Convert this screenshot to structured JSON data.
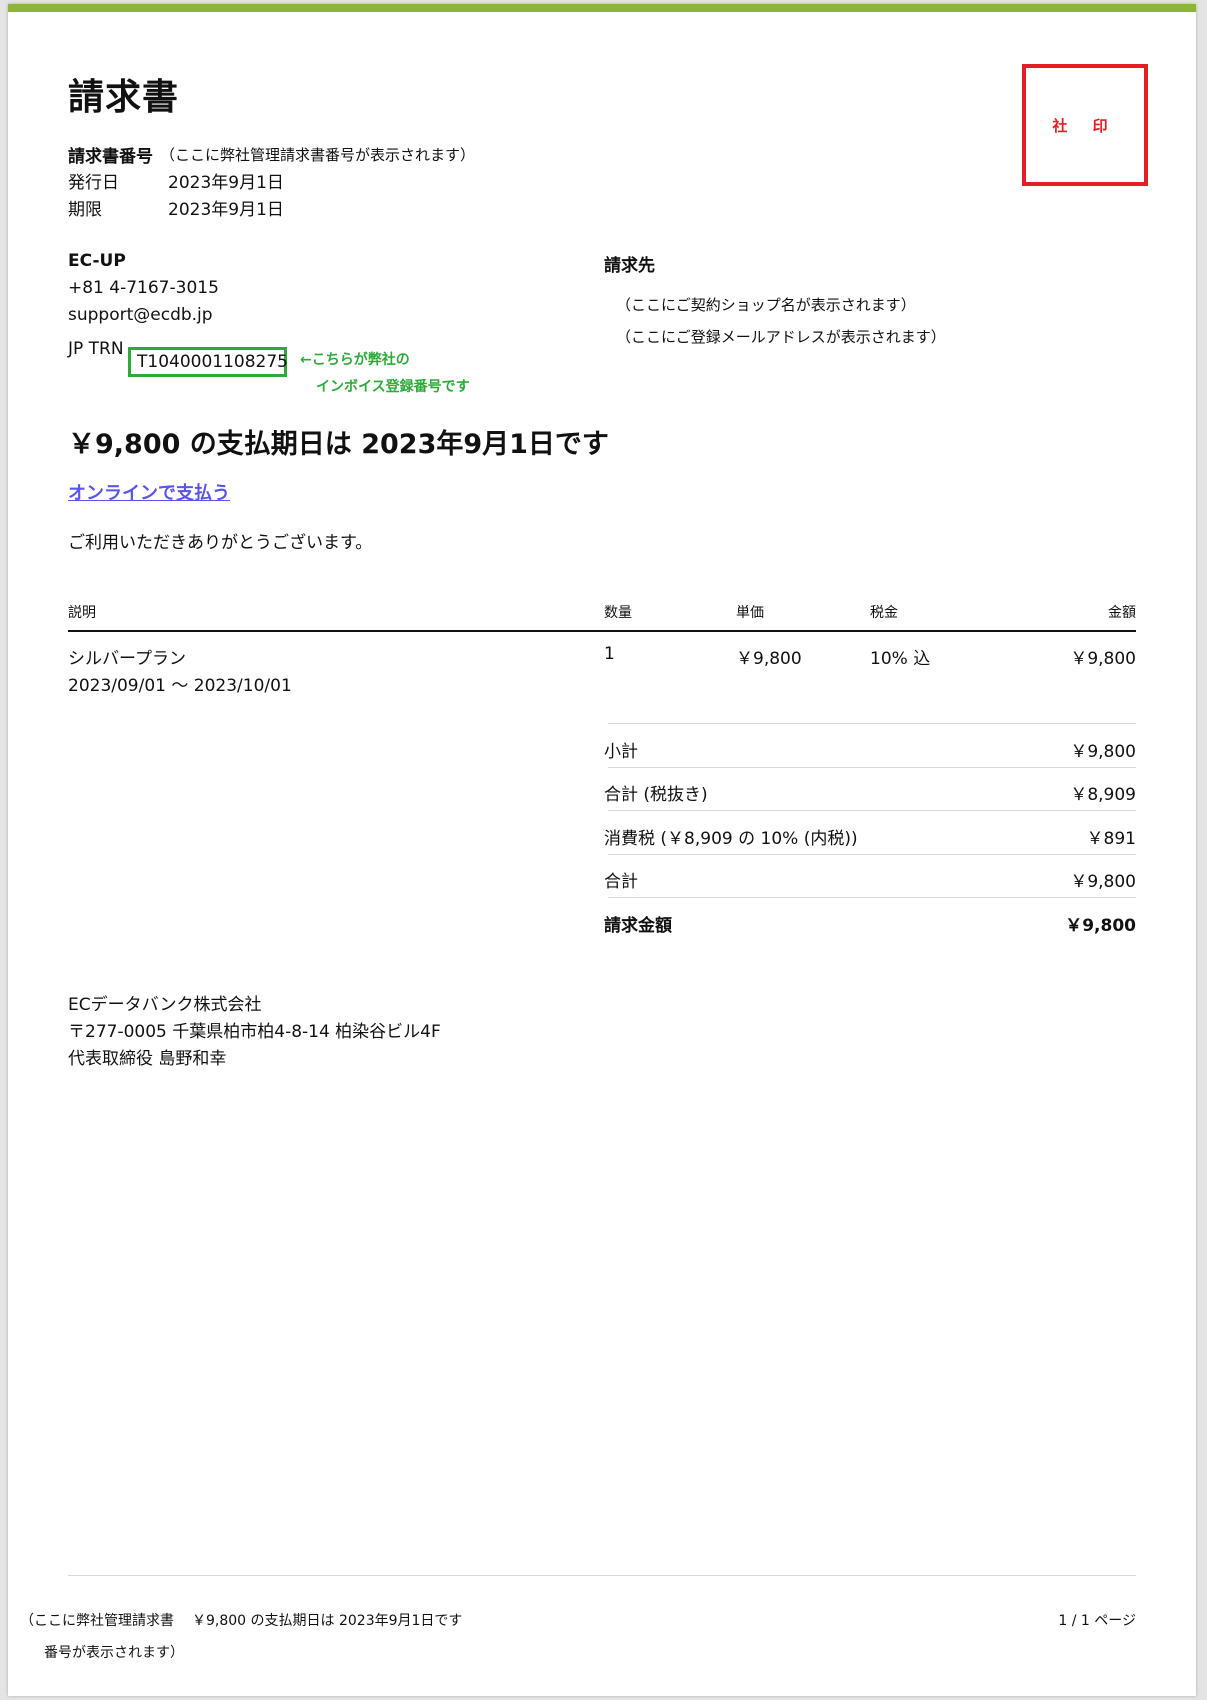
{
  "invoice": {
    "title": "請求書",
    "number_label": "請求書番号",
    "number_value": "（ここに弊社管理請求書番号が表示されます）",
    "issue_label": "発行日",
    "issue_date": "2023年9月1日",
    "due_label": "期限",
    "due_date": "2023年9月1日"
  },
  "stamp": {
    "text": "社 印"
  },
  "seller": {
    "name": "EC-UP",
    "phone": "+81 4-7167-3015",
    "email": "support@ecdb.jp",
    "trn_label": "JP TRN",
    "trn_value": "T1040001108275",
    "trn_note_1": "←こちらが弊社の",
    "trn_note_2": "インボイス登録番号です"
  },
  "bill_to": {
    "label": "請求先",
    "shop": "（ここにご契約ショップ名が表示されます）",
    "email": "（ここにご登録メールアドレスが表示されます）"
  },
  "headline": "￥9,800 の支払期日は 2023年9月1日です",
  "pay_link": "オンラインで支払う",
  "thanks": "ご利用いただきありがとうございます。",
  "table": {
    "headers": {
      "desc": "説明",
      "qty": "数量",
      "unit": "単価",
      "tax": "税金",
      "amount": "金額"
    },
    "rows": [
      {
        "desc": "シルバープラン",
        "period": "2023/09/01 〜 2023/10/01",
        "qty": "1",
        "unit": "￥9,800",
        "tax": "10% 込",
        "amount": "￥9,800"
      }
    ]
  },
  "summary": [
    {
      "label": "小計",
      "value": "￥9,800"
    },
    {
      "label": "合計 (税抜き)",
      "value": "￥8,909"
    },
    {
      "label": "消費税 (￥8,909 の 10% (内税))",
      "value": "￥891"
    },
    {
      "label": "合計",
      "value": "￥9,800"
    },
    {
      "label": "請求金額",
      "value": "￥9,800"
    }
  ],
  "company": {
    "name": "ECデータバンク株式会社",
    "address": "〒277-0005 千葉県柏市柏4-8-14 柏染谷ビル4F",
    "rep": "代表取締役 島野和幸"
  },
  "footer": {
    "number_1": "（ここに弊社管理請求書",
    "number_2": "番号が表示されます）",
    "due": "￥9,800 の支払期日は 2023年9月1日です",
    "page": "1 / 1 ページ"
  }
}
